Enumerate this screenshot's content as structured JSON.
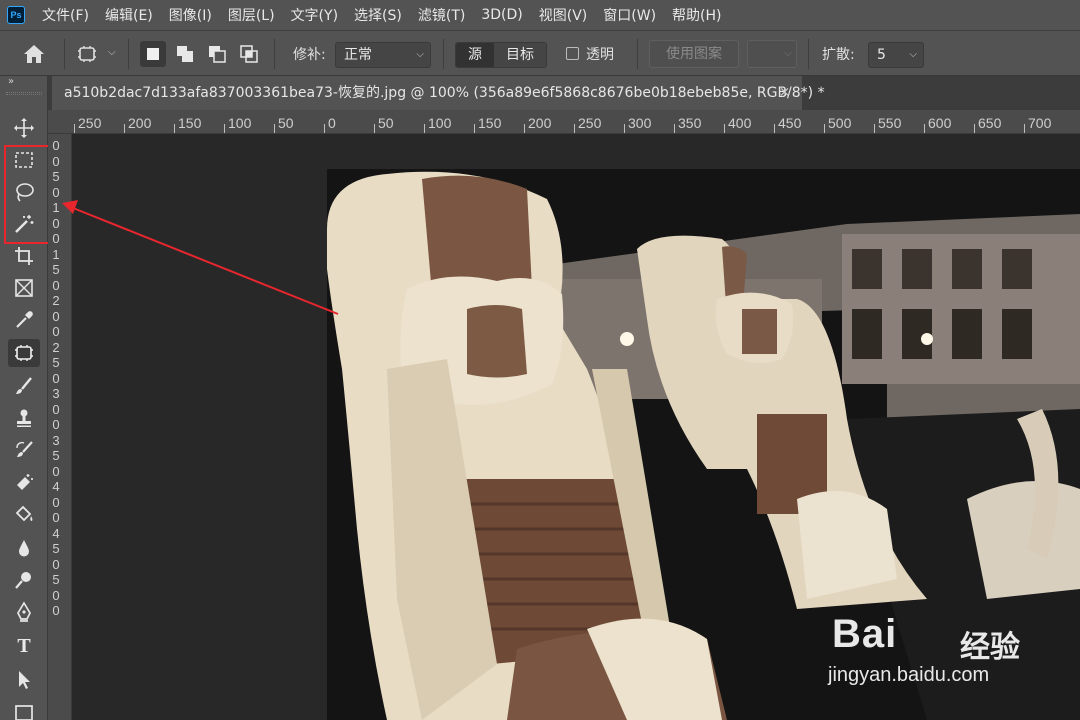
{
  "app": {
    "logo": "Ps"
  },
  "menu": [
    "文件(F)",
    "编辑(E)",
    "图像(I)",
    "图层(L)",
    "文字(Y)",
    "选择(S)",
    "滤镜(T)",
    "3D(D)",
    "视图(V)",
    "窗口(W)",
    "帮助(H)"
  ],
  "options": {
    "patch_label": "修补:",
    "patch_mode": "正常",
    "source_label": "源",
    "target_label": "目标",
    "transparent_label": "透明",
    "use_pattern_label": "使用图案",
    "diffuse_label": "扩散:",
    "diffuse_value": "5"
  },
  "toolbar": {
    "collapse": "»",
    "tools": [
      "move-tool",
      "rectangular-marquee-tool",
      "lasso-tool",
      "magic-wand-tool",
      "crop-tool",
      "frame-tool",
      "eyedropper-tool",
      "patch-tool",
      "brush-tool",
      "clone-stamp-tool",
      "history-brush-tool",
      "eraser-tool",
      "paint-bucket-tool",
      "blur-tool",
      "dodge-tool",
      "pen-tool",
      "type-tool",
      "path-selection-tool",
      "rectangle-tool"
    ],
    "type_tool_glyph": "T",
    "active_tool": "patch-tool"
  },
  "document": {
    "tab_title": "a510b2dac7d133afa837003361bea73-恢复的.jpg @ 100% (356a89e6f5868c8676be0b18ebeb85e, RGB/8*) *",
    "close": "×"
  },
  "rulers": {
    "horizontal": [
      "250",
      "200",
      "150",
      "100",
      "50",
      "0",
      "50",
      "100",
      "150",
      "200",
      "250",
      "300",
      "350",
      "400",
      "450",
      "500",
      "550",
      "600",
      "650",
      "700"
    ],
    "vertical": [
      "0",
      "0",
      "5",
      "0",
      "1",
      "0",
      "0",
      "1",
      "5",
      "0",
      "2",
      "0",
      "0",
      "2",
      "5",
      "0",
      "3",
      "0",
      "0",
      "3",
      "5",
      "0",
      "4",
      "0",
      "0",
      "4",
      "5",
      "0",
      "5",
      "0",
      "0"
    ]
  },
  "watermark": {
    "logo": "Bai",
    "logo_tail": "经验",
    "url": "jingyan.baidu.com"
  },
  "colors": {
    "accent": "#31a8ff",
    "highlight": "#e8262d",
    "panel": "#535353",
    "canvas_bg": "#282828"
  }
}
